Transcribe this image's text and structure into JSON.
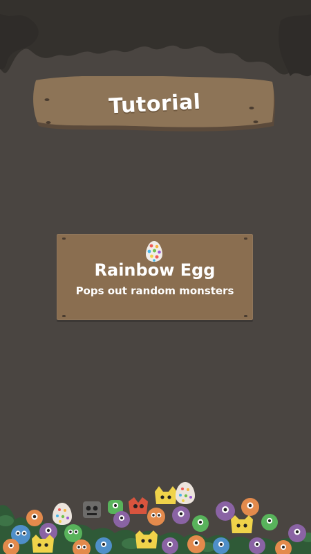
{
  "screen": {
    "title": "Tutorial"
  },
  "tutorial_card": {
    "icon": "rainbow-egg-icon",
    "item_name": "Rainbow Egg",
    "description": "Pops out random monsters"
  },
  "colors": {
    "background": "#4a4541",
    "canopy": "#34312d",
    "wood_sign": "#8d7457",
    "card": "#8a6e50",
    "text": "#ffffff"
  },
  "decor": {
    "canopy": "tree-canopy",
    "bottom": "monster-pile"
  }
}
